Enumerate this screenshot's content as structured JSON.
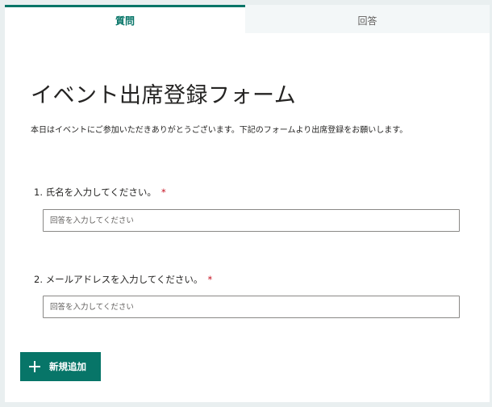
{
  "tabs": {
    "questions": "質問",
    "responses": "回答"
  },
  "form": {
    "title": "イベント出席登録フォーム",
    "description": "本日はイベントにご参加いただきありがとうございます。下記のフォームより出席登録をお願いします。"
  },
  "questions": [
    {
      "label": "1. 氏名を入力してください。",
      "required_mark": "*",
      "placeholder": "回答を入力してください"
    },
    {
      "label": "2. メールアドレスを入力してください。",
      "required_mark": "*",
      "placeholder": "回答を入力してください"
    }
  ],
  "actions": {
    "add_new": "新規追加"
  },
  "colors": {
    "accent": "#077568",
    "required": "#c50f1f",
    "background": "#e9eff0"
  },
  "icons": {
    "add": "plus-icon"
  }
}
